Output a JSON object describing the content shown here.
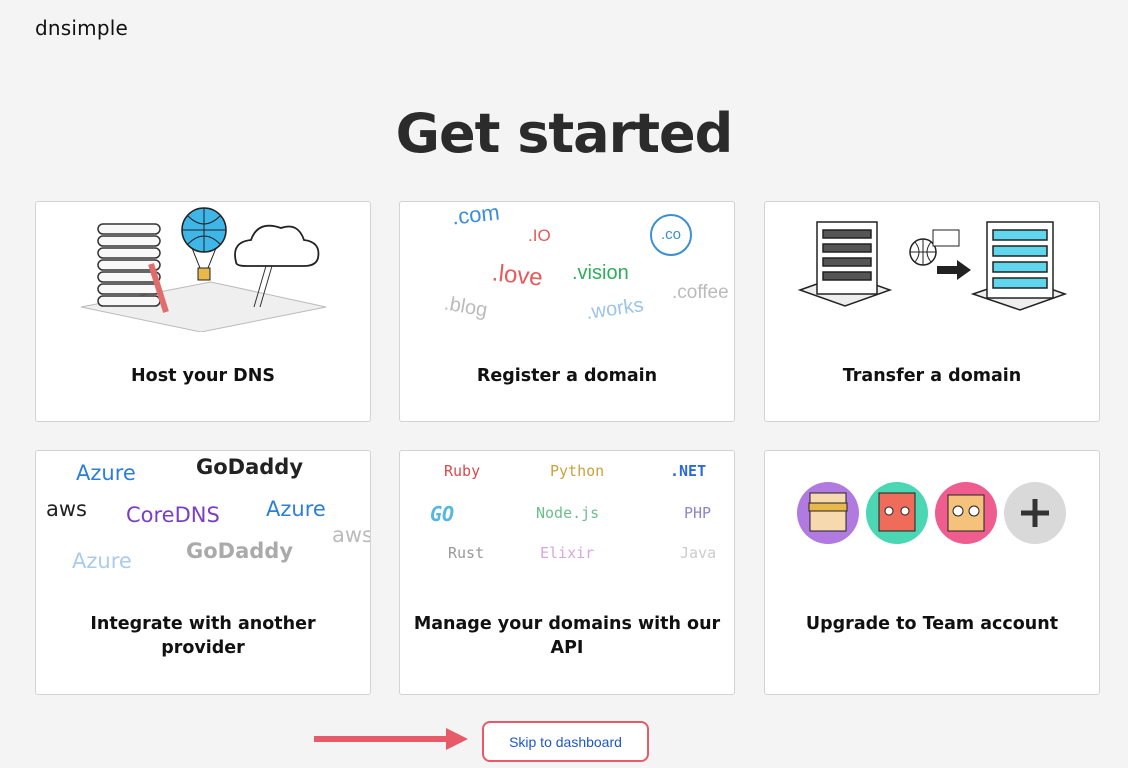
{
  "brand": {
    "logo_text": "dnsimple"
  },
  "page": {
    "title": "Get started"
  },
  "cards": [
    {
      "label": "Host your DNS"
    },
    {
      "label": "Register a domain"
    },
    {
      "label": "Transfer a domain"
    },
    {
      "label": "Integrate with another provider"
    },
    {
      "label": "Manage your domains with our API"
    },
    {
      "label": "Upgrade to Team account"
    }
  ],
  "tlds": [
    ".com",
    ".IO",
    ".co",
    ".love",
    ".vision",
    ".blog",
    ".works",
    ".coffee"
  ],
  "providers": [
    "Azure",
    "GoDaddy",
    "aws",
    "CoreDNS",
    "Azure",
    "Azure",
    "GoDaddy",
    "aws"
  ],
  "languages": [
    "Ruby",
    "Python",
    ".NET",
    "GO",
    "Node.js",
    "PHP",
    "Rust",
    "Elixir",
    "Java"
  ],
  "actions": {
    "skip_label": "Skip to dashboard"
  },
  "colors": {
    "skip_border": "#e85a67",
    "skip_text": "#1e56c8",
    "arrow": "#e85a67"
  },
  "icons": [
    "server-rack-icon",
    "balloon-icon",
    "cloud-icon",
    "building-icon",
    "globe-icon",
    "arrow-right-icon",
    "plus-icon"
  ]
}
